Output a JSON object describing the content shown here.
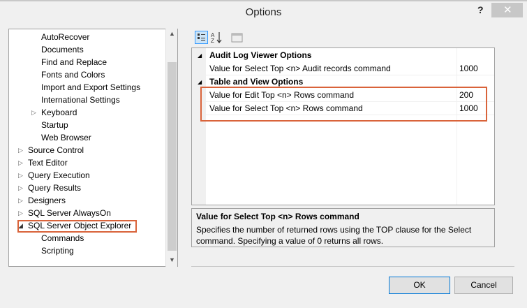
{
  "window": {
    "title": "Options",
    "help_label": "?",
    "close_label": "✕"
  },
  "tree": {
    "items": [
      {
        "label": "AutoRecover"
      },
      {
        "label": "Documents"
      },
      {
        "label": "Find and Replace"
      },
      {
        "label": "Fonts and Colors"
      },
      {
        "label": "Import and Export Settings"
      },
      {
        "label": "International Settings"
      },
      {
        "label": "Keyboard"
      },
      {
        "label": "Startup"
      },
      {
        "label": "Web Browser"
      },
      {
        "label": "Source Control"
      },
      {
        "label": "Text Editor"
      },
      {
        "label": "Query Execution"
      },
      {
        "label": "Query Results"
      },
      {
        "label": "Designers"
      },
      {
        "label": "SQL Server AlwaysOn"
      },
      {
        "label": "SQL Server Object Explorer"
      },
      {
        "label": "Commands"
      },
      {
        "label": "Scripting"
      }
    ]
  },
  "property_grid": {
    "categories": [
      {
        "name": "Audit Log Viewer Options",
        "rows": [
          {
            "name": "Value for Select Top <n> Audit records command",
            "value": "1000"
          }
        ]
      },
      {
        "name": "Table and View Options",
        "rows": [
          {
            "name": "Value for Edit Top <n> Rows command",
            "value": "200"
          },
          {
            "name": "Value for Select Top <n> Rows command",
            "value": "1000"
          }
        ]
      }
    ]
  },
  "description": {
    "title": "Value for Select Top <n> Rows command",
    "text": "Specifies the number of returned rows using the TOP clause for the Select command. Specifying a value of 0 returns all rows."
  },
  "buttons": {
    "ok": "OK",
    "cancel": "Cancel"
  },
  "colors": {
    "highlight_border": "#d9633a",
    "selected_toolbar": "#cce4f7"
  }
}
